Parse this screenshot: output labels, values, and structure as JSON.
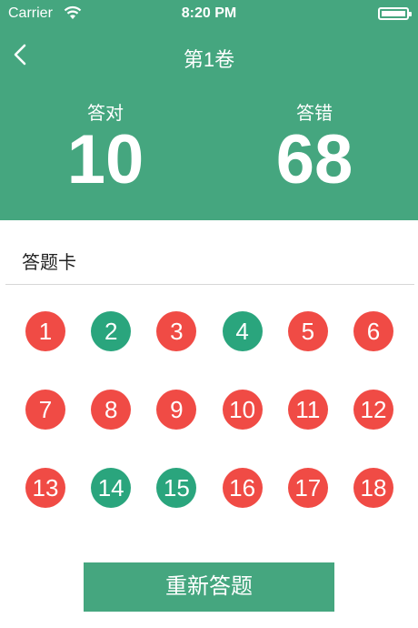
{
  "status_bar": {
    "carrier": "Carrier",
    "time": "8:20 PM"
  },
  "nav": {
    "title": "第1卷"
  },
  "stats": {
    "correct_label": "答对",
    "correct_value": "10",
    "wrong_label": "答错",
    "wrong_value": "68"
  },
  "answer_card": {
    "title": "答题卡",
    "questions": [
      {
        "number": "1",
        "status": "wrong"
      },
      {
        "number": "2",
        "status": "correct"
      },
      {
        "number": "3",
        "status": "wrong"
      },
      {
        "number": "4",
        "status": "correct"
      },
      {
        "number": "5",
        "status": "wrong"
      },
      {
        "number": "6",
        "status": "wrong"
      },
      {
        "number": "7",
        "status": "wrong"
      },
      {
        "number": "8",
        "status": "wrong"
      },
      {
        "number": "9",
        "status": "wrong"
      },
      {
        "number": "10",
        "status": "wrong"
      },
      {
        "number": "11",
        "status": "wrong"
      },
      {
        "number": "12",
        "status": "wrong"
      },
      {
        "number": "13",
        "status": "wrong"
      },
      {
        "number": "14",
        "status": "correct"
      },
      {
        "number": "15",
        "status": "correct"
      },
      {
        "number": "16",
        "status": "wrong"
      },
      {
        "number": "17",
        "status": "wrong"
      },
      {
        "number": "18",
        "status": "wrong"
      }
    ]
  },
  "footer": {
    "redo_label": "重新答题"
  },
  "colors": {
    "accent": "#45a67f",
    "correct": "#2aa57d",
    "wrong": "#f04b45"
  },
  "icons": {
    "back": "chevron-left-icon",
    "wifi": "wifi-icon",
    "battery": "battery-icon"
  }
}
